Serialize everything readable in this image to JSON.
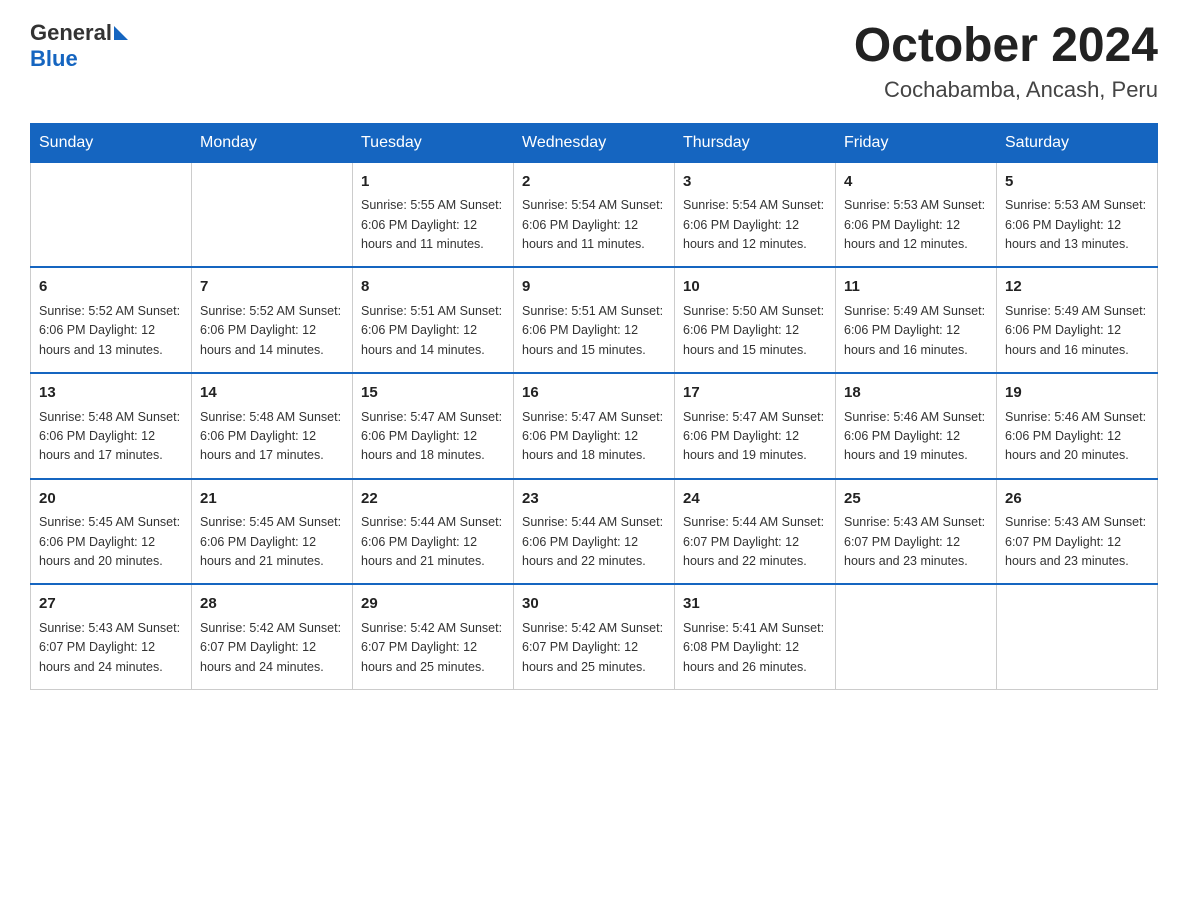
{
  "header": {
    "logo_general": "General",
    "logo_blue": "Blue",
    "month_title": "October 2024",
    "location": "Cochabamba, Ancash, Peru"
  },
  "days_of_week": [
    "Sunday",
    "Monday",
    "Tuesday",
    "Wednesday",
    "Thursday",
    "Friday",
    "Saturday"
  ],
  "weeks": [
    [
      {
        "day": "",
        "info": ""
      },
      {
        "day": "",
        "info": ""
      },
      {
        "day": "1",
        "info": "Sunrise: 5:55 AM\nSunset: 6:06 PM\nDaylight: 12 hours\nand 11 minutes."
      },
      {
        "day": "2",
        "info": "Sunrise: 5:54 AM\nSunset: 6:06 PM\nDaylight: 12 hours\nand 11 minutes."
      },
      {
        "day": "3",
        "info": "Sunrise: 5:54 AM\nSunset: 6:06 PM\nDaylight: 12 hours\nand 12 minutes."
      },
      {
        "day": "4",
        "info": "Sunrise: 5:53 AM\nSunset: 6:06 PM\nDaylight: 12 hours\nand 12 minutes."
      },
      {
        "day": "5",
        "info": "Sunrise: 5:53 AM\nSunset: 6:06 PM\nDaylight: 12 hours\nand 13 minutes."
      }
    ],
    [
      {
        "day": "6",
        "info": "Sunrise: 5:52 AM\nSunset: 6:06 PM\nDaylight: 12 hours\nand 13 minutes."
      },
      {
        "day": "7",
        "info": "Sunrise: 5:52 AM\nSunset: 6:06 PM\nDaylight: 12 hours\nand 14 minutes."
      },
      {
        "day": "8",
        "info": "Sunrise: 5:51 AM\nSunset: 6:06 PM\nDaylight: 12 hours\nand 14 minutes."
      },
      {
        "day": "9",
        "info": "Sunrise: 5:51 AM\nSunset: 6:06 PM\nDaylight: 12 hours\nand 15 minutes."
      },
      {
        "day": "10",
        "info": "Sunrise: 5:50 AM\nSunset: 6:06 PM\nDaylight: 12 hours\nand 15 minutes."
      },
      {
        "day": "11",
        "info": "Sunrise: 5:49 AM\nSunset: 6:06 PM\nDaylight: 12 hours\nand 16 minutes."
      },
      {
        "day": "12",
        "info": "Sunrise: 5:49 AM\nSunset: 6:06 PM\nDaylight: 12 hours\nand 16 minutes."
      }
    ],
    [
      {
        "day": "13",
        "info": "Sunrise: 5:48 AM\nSunset: 6:06 PM\nDaylight: 12 hours\nand 17 minutes."
      },
      {
        "day": "14",
        "info": "Sunrise: 5:48 AM\nSunset: 6:06 PM\nDaylight: 12 hours\nand 17 minutes."
      },
      {
        "day": "15",
        "info": "Sunrise: 5:47 AM\nSunset: 6:06 PM\nDaylight: 12 hours\nand 18 minutes."
      },
      {
        "day": "16",
        "info": "Sunrise: 5:47 AM\nSunset: 6:06 PM\nDaylight: 12 hours\nand 18 minutes."
      },
      {
        "day": "17",
        "info": "Sunrise: 5:47 AM\nSunset: 6:06 PM\nDaylight: 12 hours\nand 19 minutes."
      },
      {
        "day": "18",
        "info": "Sunrise: 5:46 AM\nSunset: 6:06 PM\nDaylight: 12 hours\nand 19 minutes."
      },
      {
        "day": "19",
        "info": "Sunrise: 5:46 AM\nSunset: 6:06 PM\nDaylight: 12 hours\nand 20 minutes."
      }
    ],
    [
      {
        "day": "20",
        "info": "Sunrise: 5:45 AM\nSunset: 6:06 PM\nDaylight: 12 hours\nand 20 minutes."
      },
      {
        "day": "21",
        "info": "Sunrise: 5:45 AM\nSunset: 6:06 PM\nDaylight: 12 hours\nand 21 minutes."
      },
      {
        "day": "22",
        "info": "Sunrise: 5:44 AM\nSunset: 6:06 PM\nDaylight: 12 hours\nand 21 minutes."
      },
      {
        "day": "23",
        "info": "Sunrise: 5:44 AM\nSunset: 6:06 PM\nDaylight: 12 hours\nand 22 minutes."
      },
      {
        "day": "24",
        "info": "Sunrise: 5:44 AM\nSunset: 6:07 PM\nDaylight: 12 hours\nand 22 minutes."
      },
      {
        "day": "25",
        "info": "Sunrise: 5:43 AM\nSunset: 6:07 PM\nDaylight: 12 hours\nand 23 minutes."
      },
      {
        "day": "26",
        "info": "Sunrise: 5:43 AM\nSunset: 6:07 PM\nDaylight: 12 hours\nand 23 minutes."
      }
    ],
    [
      {
        "day": "27",
        "info": "Sunrise: 5:43 AM\nSunset: 6:07 PM\nDaylight: 12 hours\nand 24 minutes."
      },
      {
        "day": "28",
        "info": "Sunrise: 5:42 AM\nSunset: 6:07 PM\nDaylight: 12 hours\nand 24 minutes."
      },
      {
        "day": "29",
        "info": "Sunrise: 5:42 AM\nSunset: 6:07 PM\nDaylight: 12 hours\nand 25 minutes."
      },
      {
        "day": "30",
        "info": "Sunrise: 5:42 AM\nSunset: 6:07 PM\nDaylight: 12 hours\nand 25 minutes."
      },
      {
        "day": "31",
        "info": "Sunrise: 5:41 AM\nSunset: 6:08 PM\nDaylight: 12 hours\nand 26 minutes."
      },
      {
        "day": "",
        "info": ""
      },
      {
        "day": "",
        "info": ""
      }
    ]
  ]
}
